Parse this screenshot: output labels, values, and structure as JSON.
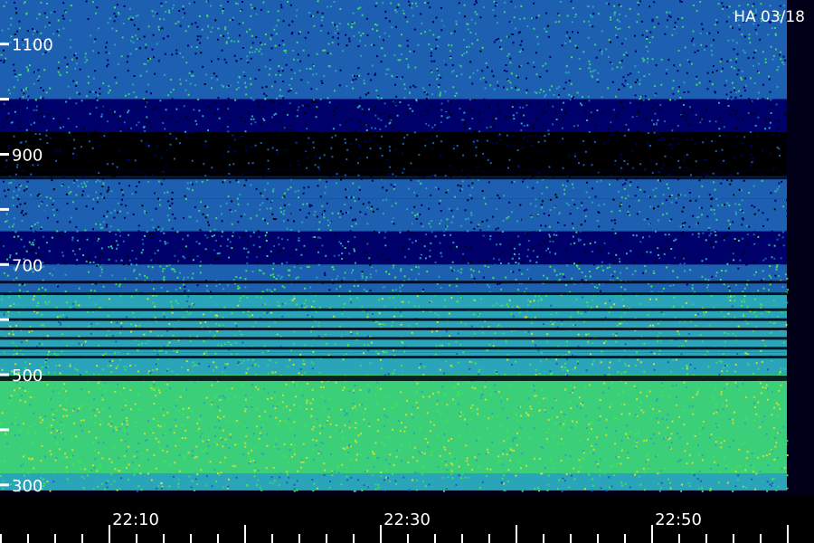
{
  "chart_data": {
    "type": "heatmap",
    "title": "HA 03/18",
    "xlabel": "",
    "ylabel": "",
    "x_ticks": [
      "22:10",
      "22:30",
      "22:50"
    ],
    "y_ticks": [
      "1100",
      "900",
      "700",
      "500",
      "300"
    ],
    "ylim": [
      280,
      1180
    ],
    "xlim_minutes": [
      0,
      60
    ],
    "grid": false,
    "colormap": [
      "#000000",
      "#00006a",
      "#1d5fb0",
      "#2aa4b8",
      "#3ccf7a",
      "#3ee84c",
      "#c7e034"
    ],
    "intensity_bands": [
      {
        "freq_range": [
          1000,
          1180
        ],
        "level": 0.42
      },
      {
        "freq_range": [
          940,
          1000
        ],
        "level": 0.18
      },
      {
        "freq_range": [
          860,
          940
        ],
        "level": 0.06
      },
      {
        "freq_range": [
          820,
          860
        ],
        "level": 0.34
      },
      {
        "freq_range": [
          760,
          820
        ],
        "level": 0.36
      },
      {
        "freq_range": [
          700,
          760
        ],
        "level": 0.3
      },
      {
        "freq_range": [
          650,
          700
        ],
        "level": 0.55
      },
      {
        "freq_range": [
          540,
          650
        ],
        "level": 0.7
      },
      {
        "freq_range": [
          500,
          540
        ],
        "level": 0.68
      },
      {
        "freq_range": [
          320,
          500
        ],
        "level": 0.8
      },
      {
        "freq_range": [
          290,
          320
        ],
        "level": 0.6
      }
    ],
    "dark_lines_freq": [
      870,
      857,
      668,
      647,
      618,
      600,
      583,
      566,
      548,
      532,
      496
    ],
    "data_end_minute": 58
  }
}
